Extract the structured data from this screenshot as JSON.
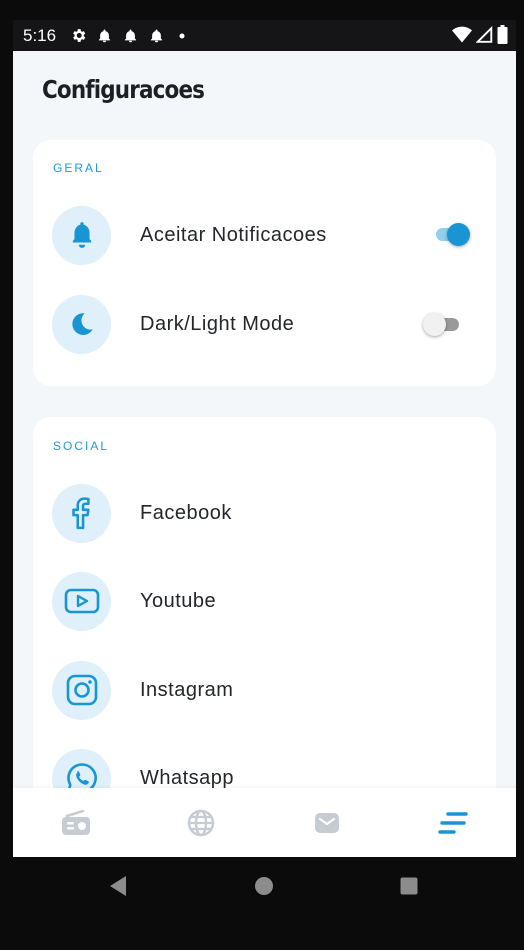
{
  "status_bar": {
    "time": "5:16",
    "left_icons": [
      "gear-icon",
      "bell-icon",
      "bell-icon",
      "bell-icon",
      "dot-icon"
    ],
    "right_icons": [
      "wifi-icon",
      "cell-signal-icon",
      "battery-icon"
    ]
  },
  "page": {
    "title": "Configuracoes"
  },
  "sections": {
    "geral": {
      "label": "GERAL",
      "items": [
        {
          "label": "Aceitar Notificacoes",
          "icon": "bell-icon",
          "toggle_on": true
        },
        {
          "label": "Dark/Light Mode",
          "icon": "moon-icon",
          "toggle_on": false
        }
      ]
    },
    "social": {
      "label": "SOCIAL",
      "items": [
        {
          "label": "Facebook",
          "icon": "facebook-icon"
        },
        {
          "label": "Youtube",
          "icon": "youtube-icon"
        },
        {
          "label": "Instagram",
          "icon": "instagram-icon"
        },
        {
          "label": "Whatsapp",
          "icon": "whatsapp-icon"
        }
      ]
    }
  },
  "tab_bar": {
    "tabs": [
      {
        "icon": "radio-icon",
        "active": false
      },
      {
        "icon": "globe-icon",
        "active": false
      },
      {
        "icon": "mail-icon",
        "active": false
      },
      {
        "icon": "settings-lines-icon",
        "active": true
      }
    ]
  },
  "colors": {
    "accent": "#1a95d3",
    "icon_bg": "#dff0fa",
    "inactive_tab": "#c6ccd1",
    "page_bg": "#f3f7fa"
  }
}
